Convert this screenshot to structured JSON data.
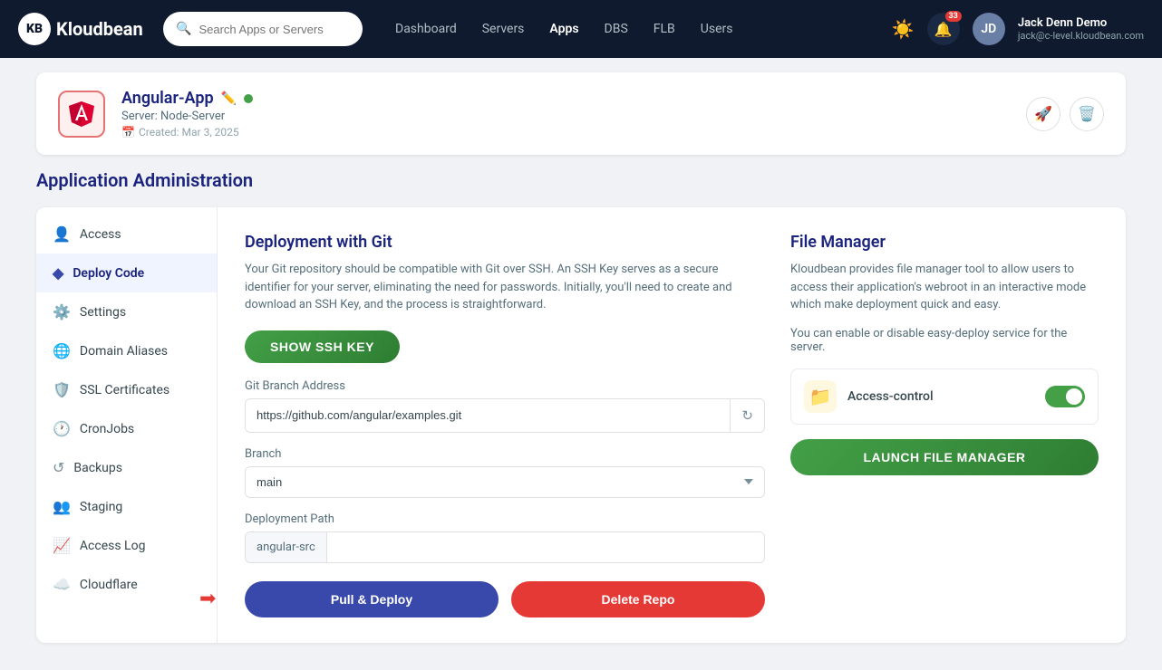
{
  "topnav": {
    "logo_text": "Kloudbean",
    "search_placeholder": "Search Apps or Servers",
    "nav_links": [
      {
        "label": "Dashboard",
        "id": "dashboard"
      },
      {
        "label": "Servers",
        "id": "servers"
      },
      {
        "label": "Apps",
        "id": "apps"
      },
      {
        "label": "DBS",
        "id": "dbs"
      },
      {
        "label": "FLB",
        "id": "flb"
      },
      {
        "label": "Users",
        "id": "users"
      }
    ],
    "notification_count": "33",
    "user_name": "Jack Denn Demo",
    "user_email": "jack@c-level.kloudbean.com"
  },
  "app_card": {
    "name": "Angular-App",
    "server": "Server: Node-Server",
    "created": "Created: Mar 3, 2025"
  },
  "section_title": "Application Administration",
  "sidebar": {
    "items": [
      {
        "label": "Access",
        "icon": "👤",
        "id": "access"
      },
      {
        "label": "Deploy Code",
        "icon": "◆",
        "id": "deploy-code",
        "active": true
      },
      {
        "label": "Settings",
        "icon": "⚙",
        "id": "settings"
      },
      {
        "label": "Domain Aliases",
        "icon": "🌐",
        "id": "domain-aliases"
      },
      {
        "label": "SSL Certificates",
        "icon": "🛡",
        "id": "ssl-certificates"
      },
      {
        "label": "CronJobs",
        "icon": "🕐",
        "id": "cronjobs"
      },
      {
        "label": "Backups",
        "icon": "↺",
        "id": "backups"
      },
      {
        "label": "Staging",
        "icon": "👥",
        "id": "staging"
      },
      {
        "label": "Access Log",
        "icon": "📈",
        "id": "access-log"
      },
      {
        "label": "Cloudflare",
        "icon": "☁",
        "id": "cloudflare"
      }
    ]
  },
  "git_section": {
    "title": "Deployment with Git",
    "description": "Your Git repository should be compatible with Git over SSH. An SSH Key serves as a secure identifier for your server, eliminating the need for passwords. Initially, you'll need to create and download an SSH Key, and the process is straightforward.",
    "ssh_button_label": "SHOW SSH KEY",
    "git_branch_label": "Git Branch Address",
    "git_branch_value": "https://github.com/angular/examples.git",
    "branch_label": "Branch",
    "branch_value": "main",
    "deployment_path_label": "Deployment Path",
    "deployment_path_prefix": "angular-src",
    "deployment_path_value": "",
    "pull_button_label": "Pull & Deploy",
    "delete_button_label": "Delete Repo"
  },
  "file_manager": {
    "title": "File Manager",
    "description": "Kloudbean provides file manager tool to allow users to access their application's webroot in an interactive mode which make deployment quick and easy.",
    "easy_deploy_note": "You can enable or disable easy-deploy service for the server.",
    "access_control_label": "Access-control",
    "access_control_enabled": true,
    "launch_button_label": "LAUNCH FILE MANAGER"
  }
}
